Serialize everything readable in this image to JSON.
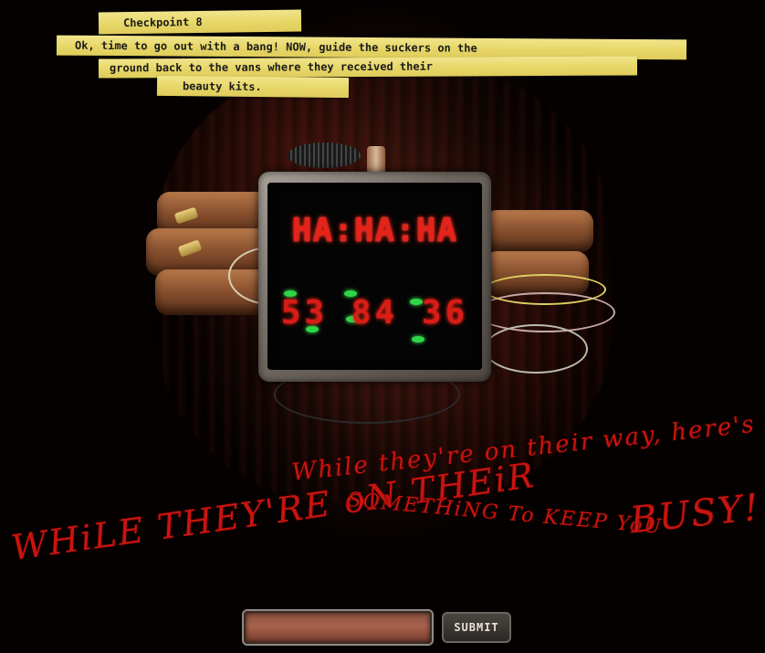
{
  "checkpoint": {
    "title": "Checkpoint 8",
    "instructions": [
      "Ok, time to go out with a bang!  NOW, guide the suckers on the",
      "ground back to the vans where they received their",
      "beauty kits."
    ]
  },
  "bomb": {
    "display_top": "HA:HA:HA",
    "display_bottom": "53 84 36"
  },
  "taunt": {
    "line1": "While they're on their way, here's a Little",
    "line2a": "While they're on their way,",
    "line2_start": "WHiLE THEY'RE oN THEiR",
    "line2b": "SOMETHiNG To KEEP YoU",
    "busy": "BUSY!"
  },
  "form": {
    "input_value": "",
    "submit_label": "SUBMIT"
  },
  "colors": {
    "tape": "#e8d86a",
    "scrawl_red": "#c8140f",
    "led_red": "#e5231a",
    "led_green": "#2fd64a"
  }
}
